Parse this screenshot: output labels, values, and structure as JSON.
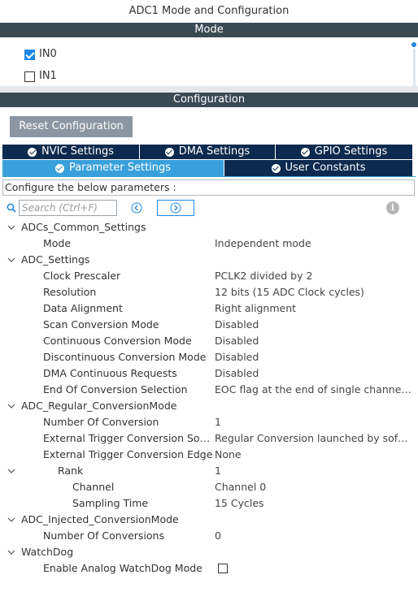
{
  "window": {
    "title": "ADC1 Mode and Configuration"
  },
  "mode_section": {
    "header": "Mode",
    "items": [
      {
        "label": "IN0",
        "checked": true
      },
      {
        "label": "IN1",
        "checked": false
      }
    ]
  },
  "config_section": {
    "header": "Configuration",
    "reset_label": "Reset Configuration",
    "tabs_row1": [
      "NVIC Settings",
      "DMA Settings",
      "GPIO Settings"
    ],
    "tabs_row2": [
      "Parameter Settings",
      "User Constants"
    ],
    "active_tab": "Parameter Settings",
    "description": "Configure the below parameters :",
    "search_placeholder": "Search (Ctrl+F)"
  },
  "tree": [
    {
      "label": "ADCs_Common_Settings",
      "value": ""
    },
    {
      "label": "Mode",
      "value": "Independent mode"
    },
    {
      "label": "ADC_Settings",
      "value": ""
    },
    {
      "label": "Clock Prescaler",
      "value": "PCLK2 divided by 2"
    },
    {
      "label": "Resolution",
      "value": "12 bits (15 ADC Clock cycles)"
    },
    {
      "label": "Data Alignment",
      "value": "Right alignment"
    },
    {
      "label": "Scan Conversion Mode",
      "value": "Disabled"
    },
    {
      "label": "Continuous Conversion Mode",
      "value": "Disabled"
    },
    {
      "label": "Discontinuous Conversion Mode",
      "value": "Disabled"
    },
    {
      "label": "DMA Continuous Requests",
      "value": "Disabled"
    },
    {
      "label": "End Of Conversion Selection",
      "value": "EOC flag at the end of single channel c..."
    },
    {
      "label": "ADC_Regular_ConversionMode",
      "value": ""
    },
    {
      "label": "Number Of Conversion",
      "value": "1"
    },
    {
      "label": "External Trigger Conversion Sour...",
      "value": "Regular Conversion launched by softw..."
    },
    {
      "label": "External Trigger Conversion Edge",
      "value": "None"
    },
    {
      "label": "Rank",
      "value": "1"
    },
    {
      "label": "Channel",
      "value": "Channel 0"
    },
    {
      "label": "Sampling Time",
      "value": "15 Cycles"
    },
    {
      "label": "ADC_Injected_ConversionMode",
      "value": ""
    },
    {
      "label": "Number Of Conversions",
      "value": "0"
    },
    {
      "label": "WatchDog",
      "value": ""
    },
    {
      "label": "Enable Analog WatchDog Mode",
      "value": ""
    }
  ],
  "colors": {
    "band": "#3a4a55",
    "tab_dark": "#0c2a4d",
    "tab_active": "#39a0dc",
    "accent": "#1e88e5"
  }
}
